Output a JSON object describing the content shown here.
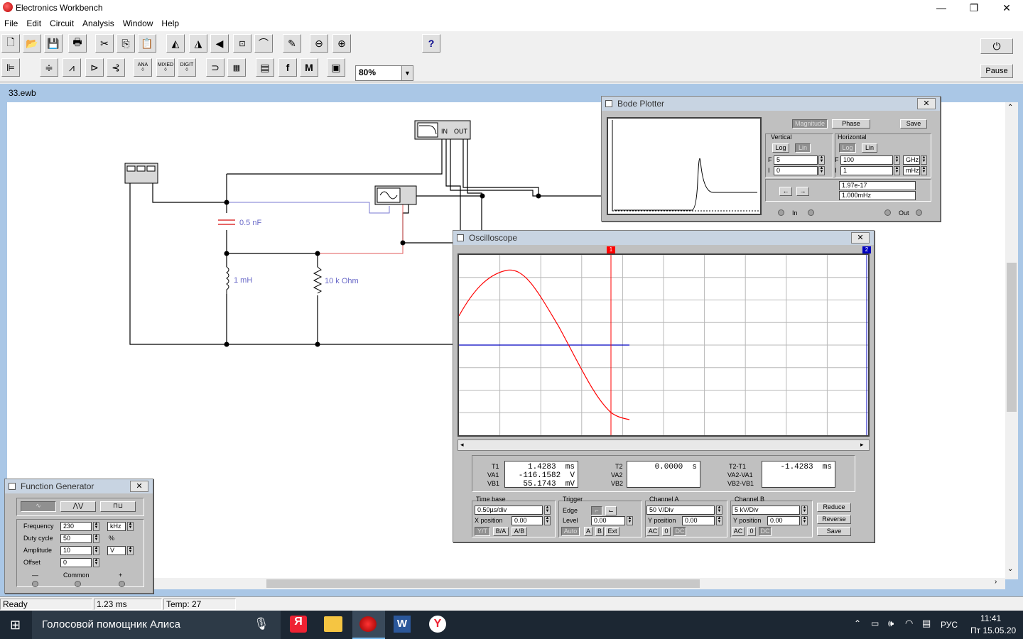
{
  "window": {
    "title": "Electronics Workbench",
    "min": "—",
    "max": "❐",
    "close": "✕"
  },
  "menu": [
    "File",
    "Edit",
    "Circuit",
    "Analysis",
    "Window",
    "Help"
  ],
  "toolbar": {
    "zoom": "80%",
    "help": "?",
    "pause": "Pause",
    "mixed_labels": [
      "ANA",
      "MIXED",
      "DIGIT"
    ]
  },
  "document": {
    "title": "33.ewb"
  },
  "circuit": {
    "capacitor": "0.5 nF",
    "inductor": "1 mH",
    "resistor": "10 k Ohm",
    "bode_terminals": {
      "in": "IN",
      "out": "OUT"
    }
  },
  "bode": {
    "title": "Bode Plotter",
    "buttons": {
      "magnitude": "Magnitude",
      "phase": "Phase",
      "save": "Save"
    },
    "vertical": {
      "label": "Vertical",
      "log": "Log",
      "lin": "Lin",
      "f_label": "F",
      "i_label": "I",
      "f": "5",
      "i": "0"
    },
    "horizontal": {
      "label": "Horizontal",
      "log": "Log",
      "lin": "Lin",
      "f_label": "F",
      "i_label": "I",
      "f": "100",
      "f_unit": "GHz",
      "i": "1",
      "i_unit": "mHz"
    },
    "readout_value": "1.97e-17",
    "readout_freq": "1.000mHz",
    "in_label": "In",
    "out_label": "Out"
  },
  "oscilloscope": {
    "title": "Oscilloscope",
    "t1": "T1",
    "va1": "VA1",
    "vb1": "VB1",
    "t1_val": "1.4283  ms",
    "va1_val": "-116.1582  V",
    "vb1_val": "55.1743  mV",
    "t2": "T2",
    "va2": "VA2",
    "vb2": "VB2",
    "t2_val": "0.0000  s",
    "dt": "T2-T1",
    "dva": "VA2-VA1",
    "dvb": "VB2-VB1",
    "dt_val": "-1.4283  ms",
    "timebase": {
      "label": "Time base",
      "value": "0.50µs/div",
      "xpos_label": "X position",
      "xpos": "0.00",
      "modes": [
        "Y/T",
        "B/A",
        "A/B"
      ]
    },
    "trigger": {
      "label": "Trigger",
      "edge": "Edge",
      "level_label": "Level",
      "level": "0.00",
      "sources": [
        "Auto",
        "A",
        "B",
        "Ext"
      ]
    },
    "channel_a": {
      "label": "Channel A",
      "value": "50  V/Div",
      "ypos_label": "Y position",
      "ypos": "0.00",
      "coupling": [
        "AC",
        "0",
        "DC"
      ]
    },
    "channel_b": {
      "label": "Channel B",
      "value": "5  kV/Div",
      "ypos_label": "Y position",
      "ypos": "0.00",
      "coupling": [
        "AC",
        "0",
        "DC"
      ]
    },
    "buttons": {
      "reduce": "Reduce",
      "reverse": "Reverse",
      "save": "Save"
    },
    "cursor1": "1",
    "cursor2": "2"
  },
  "fgen": {
    "title": "Function Generator",
    "frequency_label": "Frequency",
    "frequency": "230",
    "frequency_unit": "kHz",
    "duty_label": "Duty cycle",
    "duty": "50",
    "duty_unit": "%",
    "amplitude_label": "Amplitude",
    "amplitude": "10",
    "amplitude_unit": "V",
    "offset_label": "Offset",
    "offset": "0",
    "minus": "—",
    "common": "Common",
    "plus": "+"
  },
  "status": {
    "ready": "Ready",
    "time": "1.23 ms",
    "temp": "Temp:  27"
  },
  "taskbar": {
    "search": "Голосовой помощник Алиса",
    "lang": "РУС",
    "time": "11:41",
    "date": "Пт 15.05.20"
  },
  "colors": {
    "channel_a": "#ff0000",
    "channel_b": "#0000c0",
    "schematic_wire": "#000000",
    "component_label": "#6a6ac8"
  }
}
